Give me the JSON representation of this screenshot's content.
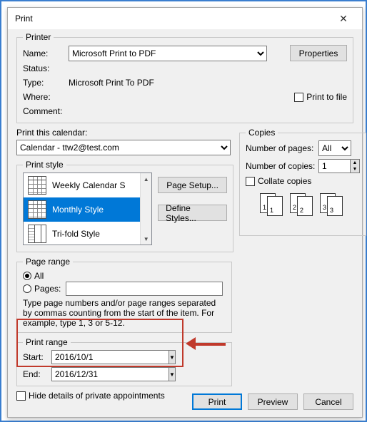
{
  "window": {
    "title": "Print"
  },
  "printer": {
    "legend": "Printer",
    "name_label": "Name:",
    "name_value": "Microsoft Print to PDF",
    "status_label": "Status:",
    "type_label": "Type:",
    "type_value": "Microsoft Print To PDF",
    "where_label": "Where:",
    "comment_label": "Comment:",
    "properties_btn": "Properties",
    "print_to_file": "Print to file"
  },
  "calendar": {
    "label": "Print this calendar:",
    "value": "Calendar - ttw2@test.com"
  },
  "style": {
    "legend": "Print style",
    "items": [
      "Weekly Calendar S",
      "Monthly Style",
      "Tri-fold Style"
    ],
    "page_setup_btn": "Page Setup...",
    "define_styles_btn": "Define Styles..."
  },
  "page_range": {
    "legend": "Page range",
    "all_label": "All",
    "pages_label": "Pages:",
    "help": "Type page numbers and/or page ranges separated by commas counting from the start of the item.  For example, type 1, 3 or 5-12."
  },
  "print_range": {
    "legend": "Print range",
    "start_label": "Start:",
    "start_value": "2016/10/1",
    "end_label": "End:",
    "end_value": "2016/12/31"
  },
  "hide_private": "Hide details of private appointments",
  "copies": {
    "legend": "Copies",
    "pages_label": "Number of pages:",
    "pages_value": "All",
    "copies_label": "Number of copies:",
    "copies_value": "1",
    "collate_label": "Collate copies",
    "p1": "1",
    "p2": "2",
    "p3": "3"
  },
  "footer": {
    "print": "Print",
    "preview": "Preview",
    "cancel": "Cancel"
  }
}
